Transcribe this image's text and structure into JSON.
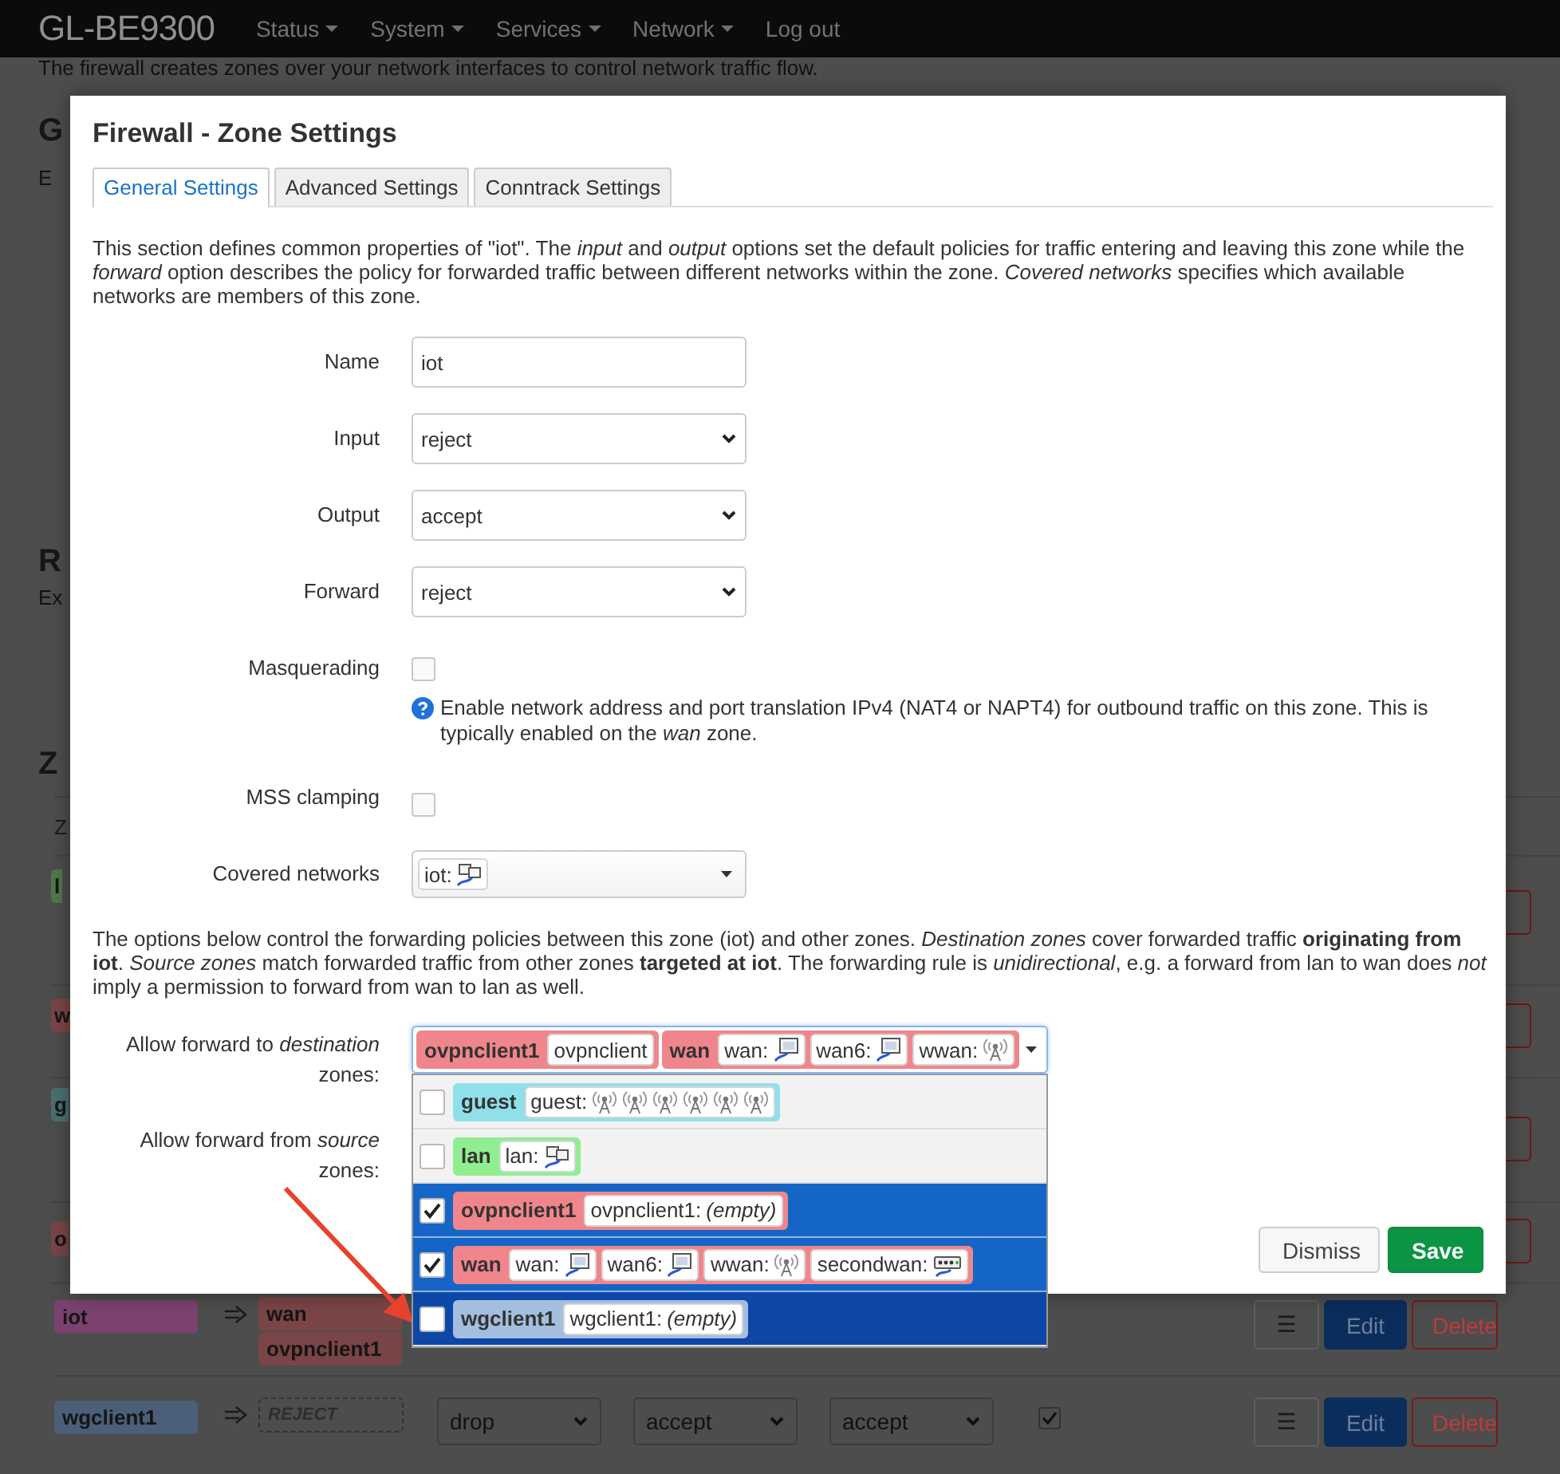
{
  "navbar": {
    "brand": "GL-BE9300",
    "menu": [
      {
        "label": "Status",
        "dropdown": true
      },
      {
        "label": "System",
        "dropdown": true
      },
      {
        "label": "Services",
        "dropdown": true
      },
      {
        "label": "Network",
        "dropdown": true
      },
      {
        "label": "Log out",
        "dropdown": false
      }
    ]
  },
  "background": {
    "intro": "The firewall creates zones over your network interfaces to control network traffic flow.",
    "heading_1": "G",
    "text_1": "E",
    "heading_2": "R",
    "text_2": "Ex",
    "heading_3": "Z",
    "table_header": "Z",
    "partial_rows": [
      {
        "zone": "l",
        "color": "#4f7a48"
      },
      {
        "zone": "w",
        "color": "#7a4546"
      },
      {
        "zone": "g",
        "color": "#4a7072"
      },
      {
        "zone": "o",
        "color": "#7a4546"
      }
    ],
    "rows": [
      {
        "zone": "iot",
        "color": "#7b4270",
        "forwards": [
          {
            "zone": "wan",
            "color": "#7a4546"
          },
          {
            "zone": "ovpnclient1",
            "color": "#7a4546"
          }
        ],
        "actions": [
          "☰",
          "Edit",
          "Delete"
        ]
      },
      {
        "zone": "wgclient1",
        "color": "#4b5f78",
        "forwards": [],
        "forward_placeholder": "REJECT",
        "input": "drop",
        "output": "accept",
        "forward": "accept",
        "masquerade": true,
        "actions": [
          "☰",
          "Edit",
          "Delete"
        ]
      }
    ]
  },
  "modal": {
    "title": "Firewall - Zone Settings",
    "tabs": [
      {
        "label": "General Settings",
        "selected": true
      },
      {
        "label": "Advanced Settings",
        "selected": false
      },
      {
        "label": "Conntrack Settings",
        "selected": false
      }
    ],
    "description": "This section defines common properties of \"iot\". The *input* and *output* options set the default policies for traffic entering and leaving this zone while the *forward* option describes the policy for forwarded traffic between different networks within the zone. *Covered networks* specifies which available networks are members of this zone.",
    "fields": [
      {
        "kind": "text",
        "label": "Name",
        "value": "iot"
      },
      {
        "kind": "select",
        "label": "Input",
        "value": "reject"
      },
      {
        "kind": "select",
        "label": "Output",
        "value": "accept"
      },
      {
        "kind": "select",
        "label": "Forward",
        "value": "reject"
      },
      {
        "kind": "checkbox",
        "label": "Masquerading",
        "checked": false,
        "help": "Enable network address and port translation IPv4 (NAT4 or NAPT4) for outbound traffic on this zone. This is typically enabled on the *wan* zone."
      },
      {
        "kind": "checkbox",
        "label": "MSS clamping",
        "checked": false
      },
      {
        "kind": "networks",
        "label": "Covered networks",
        "chips": [
          {
            "label": "iot:",
            "devices": [
              {
                "kind": "bridge"
              }
            ]
          }
        ]
      }
    ],
    "forwarding_text": "The options below control the forwarding policies between this zone (iot) and other zones. *Destination zones* cover forwarded traffic **originating from iot**. *Source zones* match forwarded traffic from other zones **targeted at iot**. The forwarding rule is *unidirectional*, e.g. a forward from lan to wan does *not* imply a permission to forward from wan to lan as well.",
    "destination": {
      "label": "Allow forward to *destination* zones:",
      "chosen": [
        {
          "zone": "ovpnclient1",
          "color": "#f0868c",
          "networks": [
            {
              "label": "ovpnclient"
            }
          ]
        },
        {
          "zone": "wan",
          "color": "#f0868c",
          "networks": [
            {
              "label": "wan:",
              "devices": [
                {
                  "kind": "wired"
                }
              ]
            },
            {
              "label": "wan6:",
              "devices": [
                {
                  "kind": "wired"
                }
              ]
            },
            {
              "label": "wwan:",
              "devices": [
                {
                  "kind": "wireless"
                }
              ]
            }
          ]
        }
      ],
      "options": [
        {
          "zone": "guest",
          "color": "#90e0ea",
          "checked": false,
          "highlighted": false,
          "networks": [
            {
              "label": "guest:",
              "devices": [
                {
                  "kind": "wireless"
                },
                {
                  "kind": "wireless"
                },
                {
                  "kind": "wireless"
                },
                {
                  "kind": "wireless"
                },
                {
                  "kind": "wireless"
                },
                {
                  "kind": "wireless"
                }
              ]
            }
          ]
        },
        {
          "zone": "lan",
          "color": "#90ee90",
          "checked": false,
          "highlighted": false,
          "networks": [
            {
              "label": "lan:",
              "devices": [
                {
                  "kind": "bridge"
                }
              ]
            }
          ]
        },
        {
          "zone": "ovpnclient1",
          "color": "#f0868c",
          "checked": true,
          "highlighted": false,
          "networks": [
            {
              "label": "ovpnclient1:",
              "note": "(empty)"
            }
          ]
        },
        {
          "zone": "wan",
          "color": "#f0868c",
          "checked": true,
          "highlighted": false,
          "networks": [
            {
              "label": "wan:",
              "devices": [
                {
                  "kind": "wired"
                }
              ]
            },
            {
              "label": "wan6:",
              "devices": [
                {
                  "kind": "wired"
                }
              ]
            },
            {
              "label": "wwan:",
              "devices": [
                {
                  "kind": "wireless"
                }
              ]
            },
            {
              "label": "secondwan:",
              "devices": [
                {
                  "kind": "modem"
                }
              ]
            }
          ]
        },
        {
          "zone": "wgclient1",
          "color": "#a4bedf",
          "checked": false,
          "highlighted": true,
          "networks": [
            {
              "label": "wgclient1:",
              "note": "(empty)"
            }
          ]
        }
      ]
    },
    "source": {
      "label": "Allow forward from *source* zones:"
    },
    "buttons": [
      {
        "label": "Dismiss",
        "kind": "secondary"
      },
      {
        "label": "Save",
        "kind": "primary"
      }
    ]
  }
}
